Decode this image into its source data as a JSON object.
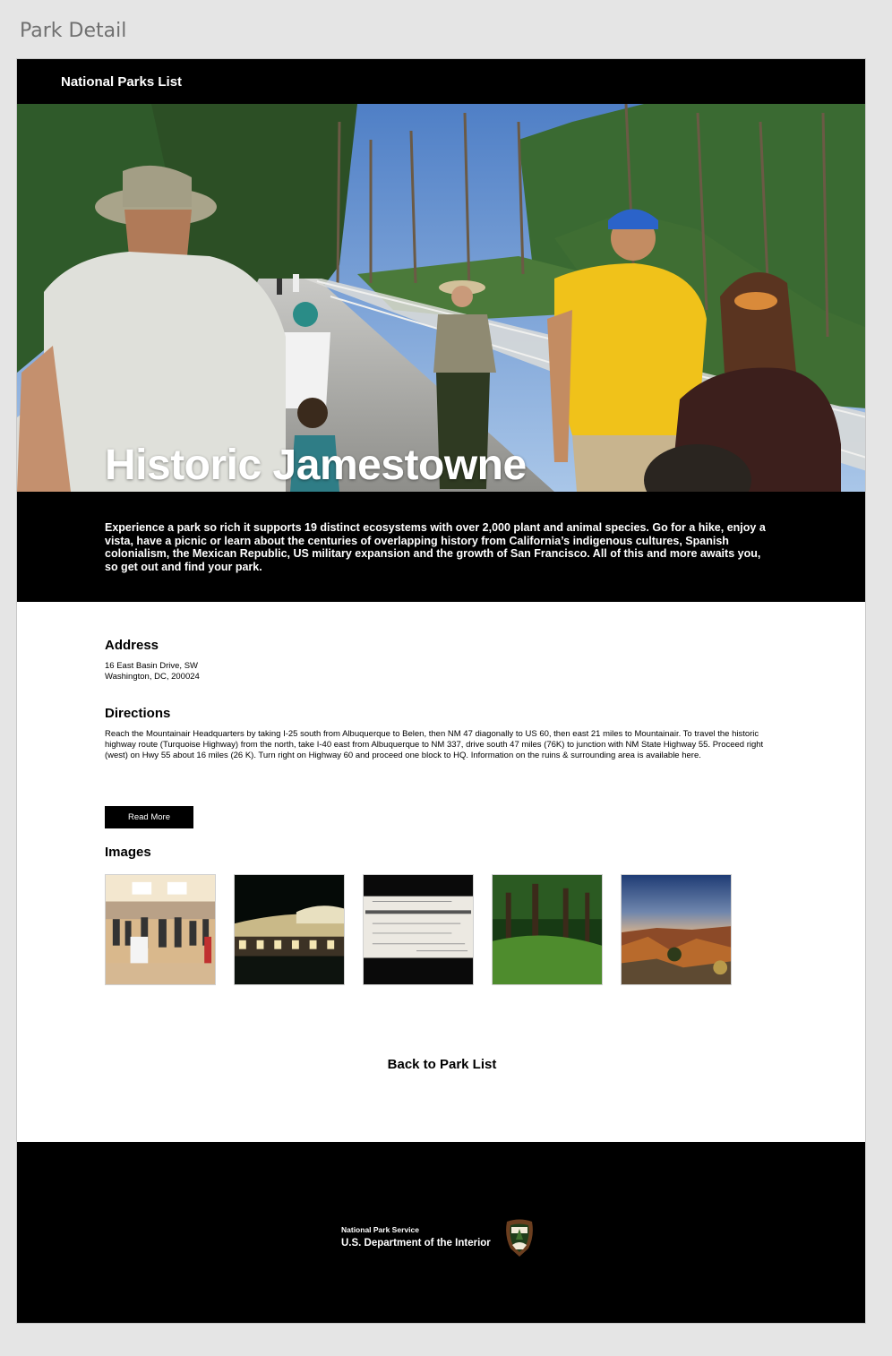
{
  "artboard": {
    "title": "Park Detail"
  },
  "header": {
    "nav_title": "National Parks List"
  },
  "hero": {
    "park_name": "Historic Jamestowne"
  },
  "intro": {
    "text": "Experience a park so rich it supports 19 distinct ecosystems with over 2,000 plant and animal species. Go for a hike, enjoy a vista, have a picnic or learn about the centuries of overlapping history from California’s indigenous cultures, Spanish colonialism, the Mexican Republic, US military expansion and the growth of San Francisco. All of this and more awaits you, so get out and find your park."
  },
  "address": {
    "heading": "Address",
    "line1": "16 East Basin Drive, SW",
    "line2": "Washington, DC, 200024"
  },
  "directions": {
    "heading": "Directions",
    "text": "Reach the Mountainair Headquarters by taking I-25 south from Albuquerque to Belen, then NM 47 diagonally to US 60, then east 21 miles to Mountainair. To travel the historic highway route (Turquoise Highway) from the north, take I-40 east from Albuquerque to NM 337, drive south 47 miles (76K) to junction with NM State Highway 55. Proceed right (west) on Hwy 55 about 16 miles (26 K). Turn right on Highway 60 and proceed one block to HQ.  Information on the ruins & surrounding area is available here.",
    "read_more_label": "Read More"
  },
  "images": {
    "heading": "Images",
    "items": [
      {
        "name": "image-crowd-hall"
      },
      {
        "name": "image-night-pavilion"
      },
      {
        "name": "image-bank-note"
      },
      {
        "name": "image-forest-meadow"
      },
      {
        "name": "image-canyon-sunset"
      }
    ]
  },
  "back_link": {
    "label": "Back to Park List"
  },
  "footer": {
    "agency": "National Park Service",
    "department": "U.S. Department of the Interior",
    "logo_icon": "nps-arrowhead-icon"
  },
  "colors": {
    "page_background": "#e5e5e5",
    "bars": "#000000",
    "content_background": "#ffffff",
    "text_on_dark": "#ffffff"
  }
}
